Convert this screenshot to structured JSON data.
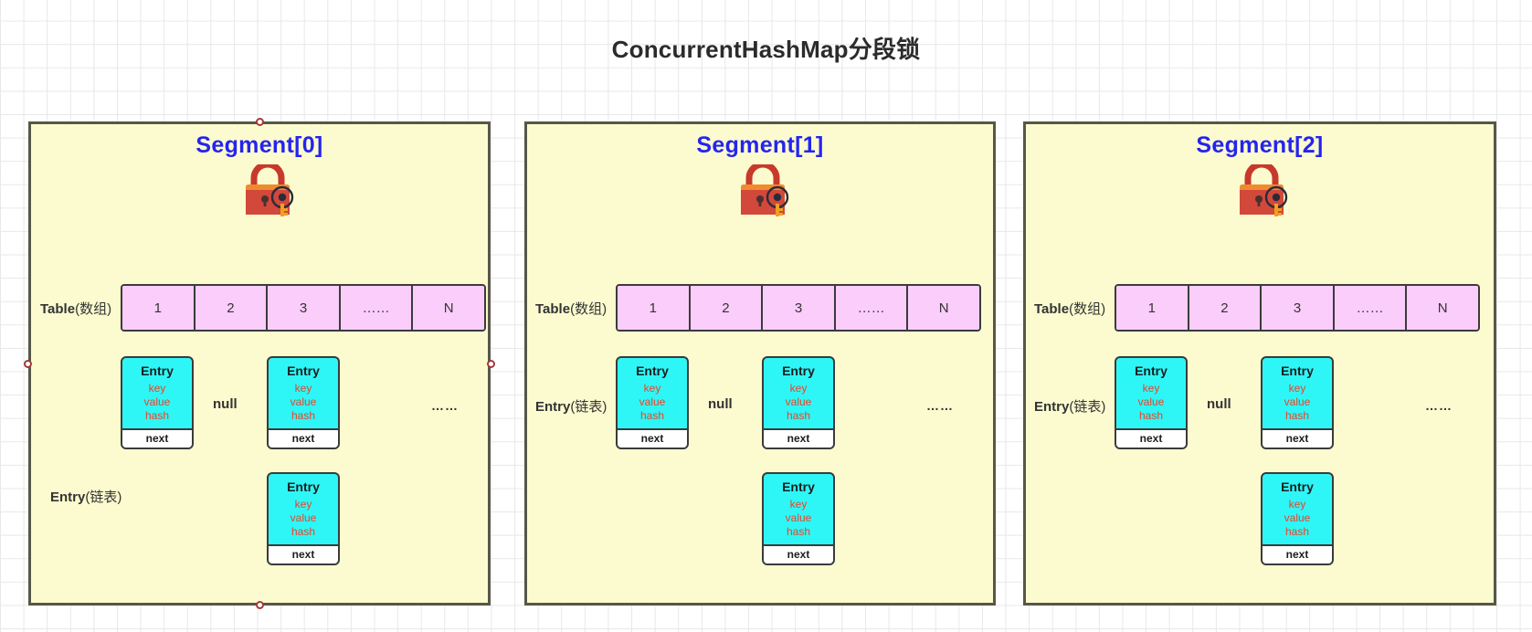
{
  "title": "ConcurrentHashMap分段锁",
  "icons": {
    "lock": "padlock-with-key-icon"
  },
  "labels": {
    "table_prefix": "Table",
    "table_suffix": "(数组)",
    "entry_prefix": "Entry",
    "entry_suffix": "(链表)",
    "null": "null",
    "dots": "……",
    "entry_head": "Entry",
    "entry_key": "key",
    "entry_value": "value",
    "entry_hash": "hash",
    "entry_next": "next"
  },
  "colors": {
    "panel_fill": "#fcfbcf",
    "panel_border": "#575748",
    "segment_title": "#2424f0",
    "table_cell": "#fbcdfb",
    "entry_fill": "#2ff6f6",
    "entry_field_text": "#e8452b",
    "handle_border": "#a33a3a",
    "grid": "#e8e8e8"
  },
  "segments": [
    {
      "title": "Segment[0]",
      "table_cells": [
        "1",
        "2",
        "3",
        "……",
        "N"
      ],
      "entries": [
        {
          "column": 1,
          "depth": 1
        },
        {
          "column": 3,
          "depth": 2
        }
      ],
      "null_column": 2,
      "dots_column": 5,
      "selected": true
    },
    {
      "title": "Segment[1]",
      "table_cells": [
        "1",
        "2",
        "3",
        "……",
        "N"
      ],
      "entries": [
        {
          "column": 1,
          "depth": 1
        },
        {
          "column": 3,
          "depth": 2
        }
      ],
      "null_column": 2,
      "dots_column": 5,
      "selected": false
    },
    {
      "title": "Segment[2]",
      "table_cells": [
        "1",
        "2",
        "3",
        "……",
        "N"
      ],
      "entries": [
        {
          "column": 1,
          "depth": 1
        },
        {
          "column": 3,
          "depth": 2
        }
      ],
      "null_column": 2,
      "dots_column": 5,
      "selected": false
    }
  ]
}
